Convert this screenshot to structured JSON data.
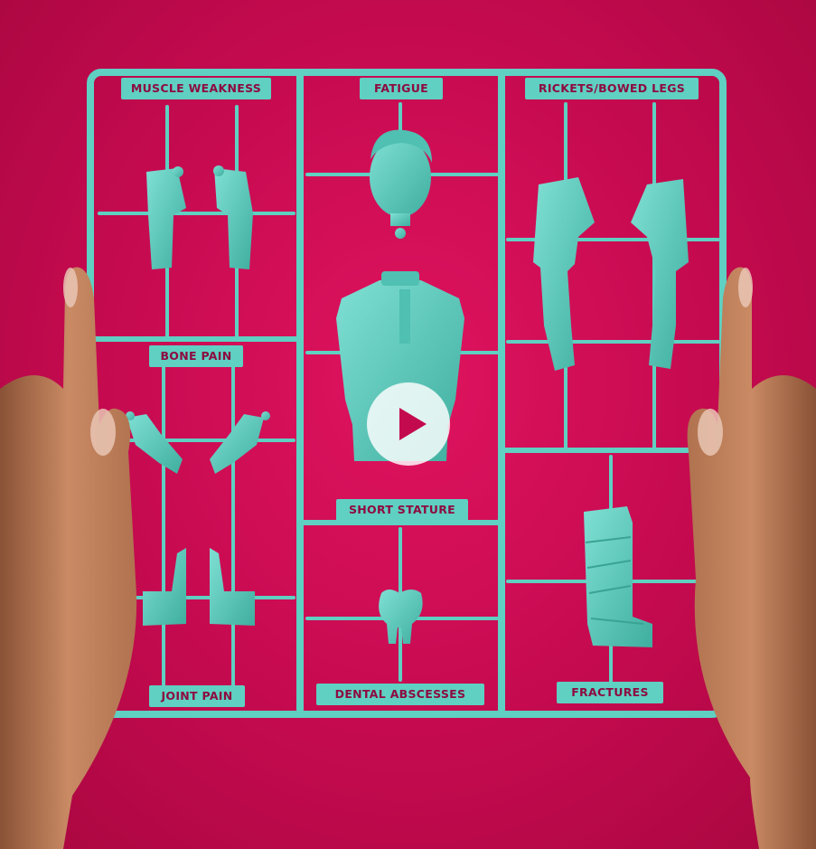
{
  "labels": {
    "muscle_weakness": "MUSCLE WEAKNESS",
    "fatigue": "FATIGUE",
    "rickets": "RICKETS/BOWED LEGS",
    "bone_pain": "BONE PAIN",
    "short_stature": "SHORT STATURE",
    "joint_pain": "JOINT PAIN",
    "dental_abscesses": "DENTAL ABSCESSES",
    "fractures": "FRACTURES"
  },
  "colors": {
    "background": "#c40a4f",
    "plastic": "#5fd0c2",
    "label_text": "#8c0b40",
    "skin": "#c98a64"
  },
  "play_button": {
    "icon": "play-icon"
  }
}
